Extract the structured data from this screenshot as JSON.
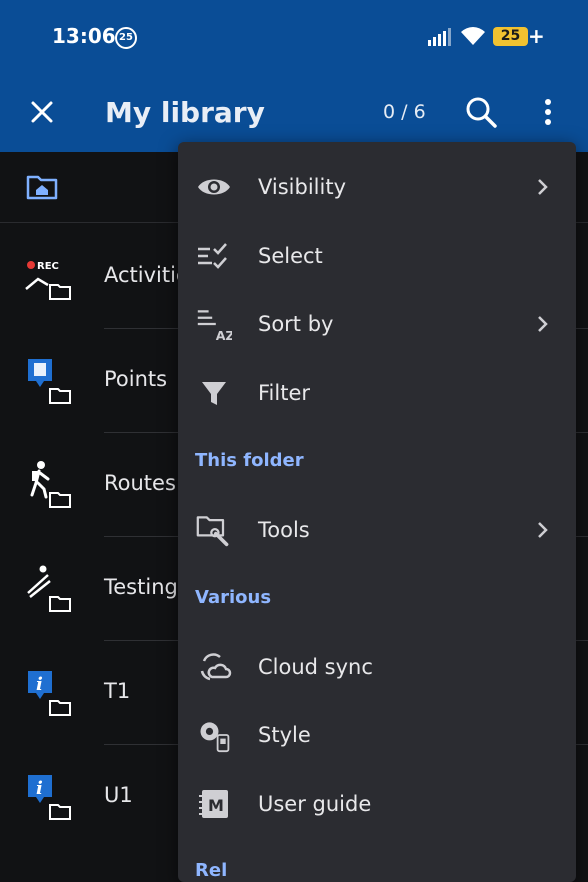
{
  "status_bar": {
    "time": "13:06",
    "notification_badge": "25",
    "battery": "25",
    "battery_plus": "+"
  },
  "app_bar": {
    "title": "My library",
    "counter": "0 / 6",
    "icons": [
      "close-icon",
      "search-icon",
      "more-vert-icon"
    ]
  },
  "list": {
    "items": [
      {
        "label": "Activities",
        "icon": "rec-track-folder-icon"
      },
      {
        "label": "Points",
        "icon": "points-folder-icon"
      },
      {
        "label": "Routes",
        "icon": "hiker-folder-icon"
      },
      {
        "label": "Testing",
        "icon": "ski-jump-folder-icon"
      },
      {
        "label": "T1",
        "icon": "info-folder-icon"
      },
      {
        "label": "U1",
        "icon": "info-folder-icon"
      }
    ]
  },
  "menu": {
    "items": {
      "visibility": "Visibility",
      "select": "Select",
      "sort_by": "Sort by",
      "filter": "Filter",
      "tools": "Tools",
      "cloud_sync": "Cloud sync",
      "style": "Style",
      "user_guide": "User guide"
    },
    "sections": {
      "this_folder": "This folder",
      "various": "Various",
      "cut_off": "Rel"
    }
  },
  "colors": {
    "app_bar": "#0a4d96",
    "background": "#111214",
    "menu_background": "#2b2c31",
    "section_header": "#8fb6ff",
    "accent_icon_blue": "#1f6fd1",
    "battery": "#f2c230"
  }
}
